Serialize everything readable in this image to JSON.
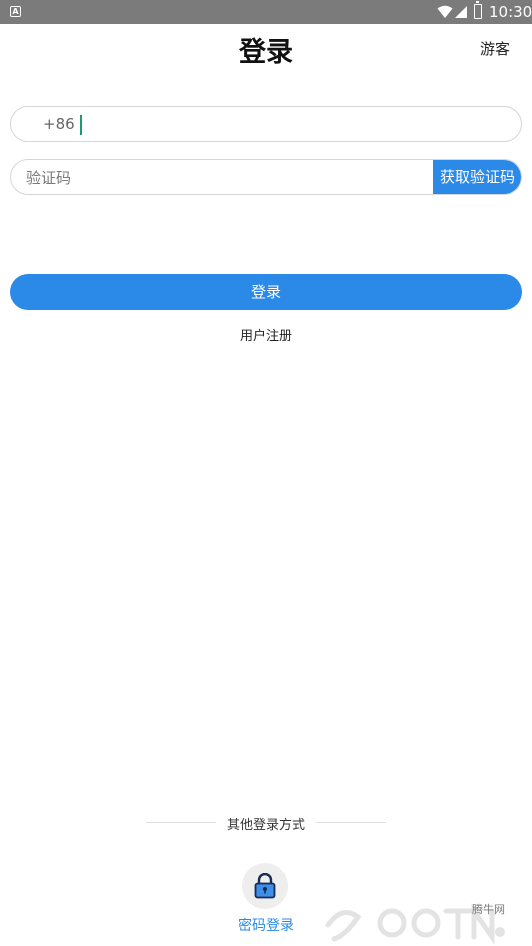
{
  "status_bar": {
    "time": "10:30",
    "app_badge": "A"
  },
  "header": {
    "title": "登录",
    "guest_label": "游客"
  },
  "phone": {
    "country_code": "+86",
    "value": "",
    "placeholder": ""
  },
  "code": {
    "placeholder": "验证码",
    "get_code_label": "获取验证码"
  },
  "actions": {
    "login_label": "登录",
    "register_label": "用户注册"
  },
  "other_methods": {
    "divider_label": "其他登录方式",
    "password_login_label": "密码登录"
  },
  "watermark": {
    "site_name": "腾牛网"
  },
  "colors": {
    "accent": "#2b8ae8",
    "status_bar": "#7b7b7b",
    "caret": "#1e9b6a"
  }
}
